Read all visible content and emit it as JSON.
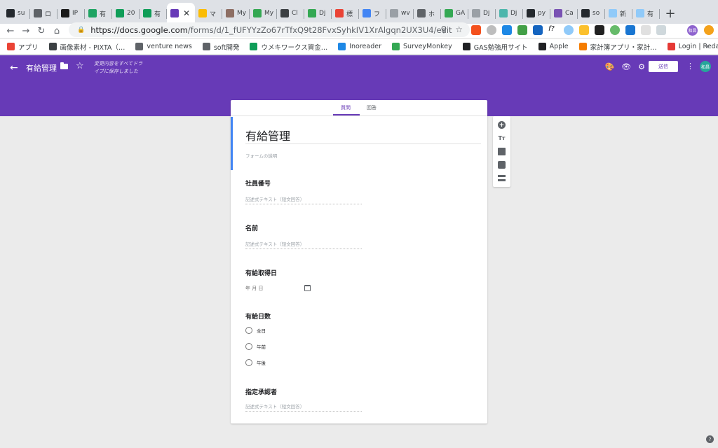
{
  "browser": {
    "tabs": [
      {
        "label": "su",
        "icon": "github-icon",
        "color": "#24292e"
      },
      {
        "label": "ロ",
        "icon": "ry-icon",
        "color": "#5f6368"
      },
      {
        "label": "IP",
        "icon": "ip-icon",
        "color": "#1a1a1a"
      },
      {
        "label": "有",
        "icon": "drive-icon",
        "color": "#1fa463"
      },
      {
        "label": "20",
        "icon": "sheets-icon",
        "color": "#0f9d58"
      },
      {
        "label": "有",
        "icon": "sheets-icon",
        "color": "#0f9d58"
      },
      {
        "label": "",
        "icon": "forms-icon",
        "color": "#673ab7"
      },
      {
        "label": "マ",
        "icon": "drive-icon",
        "color": "#fbbc04"
      },
      {
        "label": "My",
        "icon": "my-icon",
        "color": "#8d6e63"
      },
      {
        "label": "My",
        "icon": "green-circle-icon",
        "color": "#34a853"
      },
      {
        "label": "Cl",
        "icon": "cl-icon",
        "color": "#3c4043"
      },
      {
        "label": "Dj",
        "icon": "green-circle-icon",
        "color": "#34a853"
      },
      {
        "label": "標",
        "icon": "cloud-icon",
        "color": "#ea4335"
      },
      {
        "label": "フ",
        "icon": "cloud-icon",
        "color": "#4285f4"
      },
      {
        "label": "wv",
        "icon": "google-icon",
        "color": "#9aa0a6"
      },
      {
        "label": "ホ",
        "icon": "gear-icon",
        "color": "#5f6368"
      },
      {
        "label": "GA",
        "icon": "green-circle-icon",
        "color": "#34a853"
      },
      {
        "label": "Dj",
        "icon": "doc-icon",
        "color": "#9aa0a6"
      },
      {
        "label": "Dj",
        "icon": "dj-icon",
        "color": "#4db6ac"
      },
      {
        "label": "py",
        "icon": "github-icon",
        "color": "#24292e"
      },
      {
        "label": "Ca",
        "icon": "bootstrap-icon",
        "color": "#7952b3"
      },
      {
        "label": "so",
        "icon": "github-icon",
        "color": "#24292e"
      },
      {
        "label": "新",
        "icon": "new-icon",
        "color": "#90caf9"
      },
      {
        "label": "有",
        "icon": "new-icon",
        "color": "#90caf9"
      }
    ],
    "active_tab_index": 6,
    "url_host": "https://docs.google.com",
    "url_path": "/forms/d/1_fUFYYzZo67rTfxQ9t28FvxSyhkIV1XrAlgqn2UX3U4/edit",
    "bookmarks": [
      {
        "label": "アプリ",
        "color": "#ea4335"
      },
      {
        "label": "画像素材 - PIXTA（…",
        "color": "#3c4043"
      },
      {
        "label": "venture news",
        "color": "#5f6368"
      },
      {
        "label": "soft開発",
        "color": "#5f6368"
      },
      {
        "label": "ウメキワークス資金…",
        "color": "#0f9d58"
      },
      {
        "label": "Inoreader",
        "color": "#1e88e5"
      },
      {
        "label": "SurveyMonkey",
        "color": "#34a853"
      },
      {
        "label": "GAS勉強用サイト",
        "color": "#202124"
      },
      {
        "label": "Apple",
        "color": "#202124"
      },
      {
        "label": "家計簿アプリ・家計…",
        "color": "#f57c00"
      },
      {
        "label": "Login | Redash",
        "color": "#e53935"
      }
    ],
    "profile_initials": "和昌"
  },
  "header": {
    "title": "有給管理",
    "saved_text_line1": "変更内容をすべてドラ",
    "saved_text_line2": "イブに保存しました",
    "send_label": "送信",
    "avatar_initials": "和昌",
    "accent_color": "#673ab7"
  },
  "form": {
    "tabs": [
      "質問",
      "回答"
    ],
    "title": "有給管理",
    "description_placeholder": "フォームの説明",
    "questions": [
      {
        "label": "社員番号",
        "placeholder": "記述式テキスト（短文回答）"
      },
      {
        "label": "名前",
        "placeholder": "記述式テキスト（短文回答）"
      },
      {
        "label": "有給取得日",
        "date_placeholder": "年 月 日"
      },
      {
        "label": "有給日数",
        "options": [
          "全日",
          "午前",
          "午後"
        ]
      },
      {
        "label": "指定承認者",
        "placeholder": "記述式テキスト（短文回答）"
      }
    ]
  }
}
